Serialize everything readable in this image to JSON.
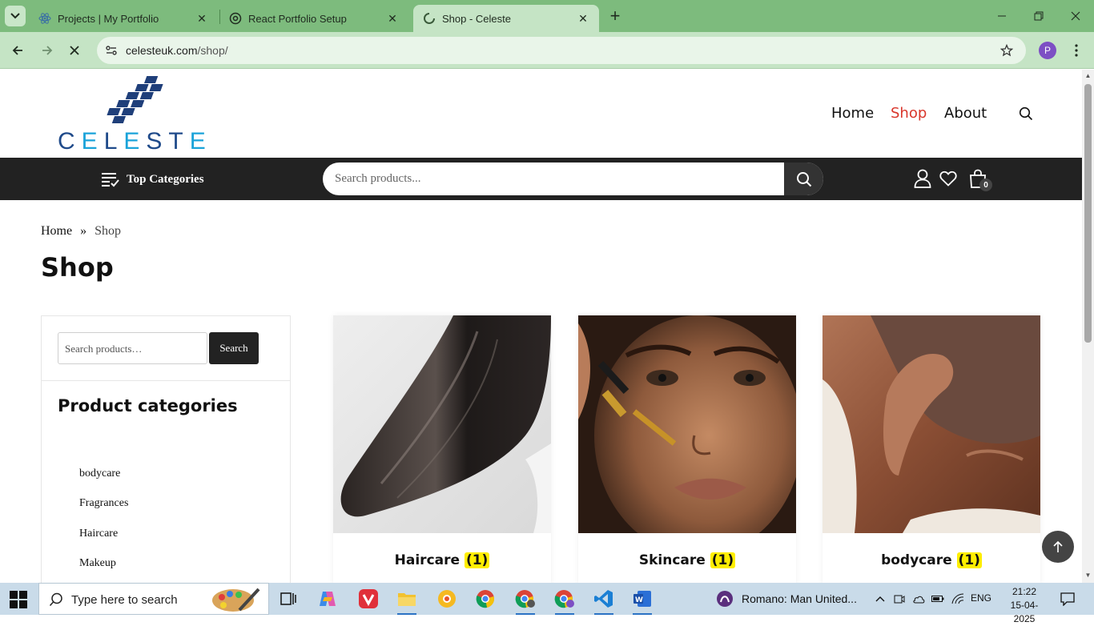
{
  "browser": {
    "tabs": [
      {
        "title": "Projects | My Portfolio",
        "icon": "react-icon"
      },
      {
        "title": "React Portfolio Setup",
        "icon": "chatgpt-icon"
      },
      {
        "title": "Shop - Celeste",
        "icon": "loading-icon"
      }
    ],
    "url_host": "celesteuk.com",
    "url_path": "/shop/",
    "profile_initial": "P",
    "accent": "#7dbb7d"
  },
  "site": {
    "logo_text": "CELESTE",
    "nav": [
      "Home",
      "Shop",
      "About"
    ],
    "active_color": "#d9362b",
    "top_categories": "Top Categories",
    "search_placeholder": "Search products...",
    "cart_count": "0"
  },
  "breadcrumb": {
    "home": "Home",
    "current": "Shop"
  },
  "page_title": "Shop",
  "sidebar": {
    "search_placeholder": "Search products…",
    "search_button": "Search",
    "categories_title": "Product categories",
    "categories": [
      "bodycare",
      "Fragrances",
      "Haircare",
      "Makeup"
    ]
  },
  "products": [
    {
      "name": "Haircare",
      "count": "(1)"
    },
    {
      "name": "Skincare",
      "count": "(1)"
    },
    {
      "name": "bodycare",
      "count": "(1)"
    }
  ],
  "taskbar": {
    "search_placeholder": "Type here to search",
    "news": "Romano: Man United...",
    "lang": "ENG",
    "time": "21:22",
    "date": "15-04-2025"
  }
}
